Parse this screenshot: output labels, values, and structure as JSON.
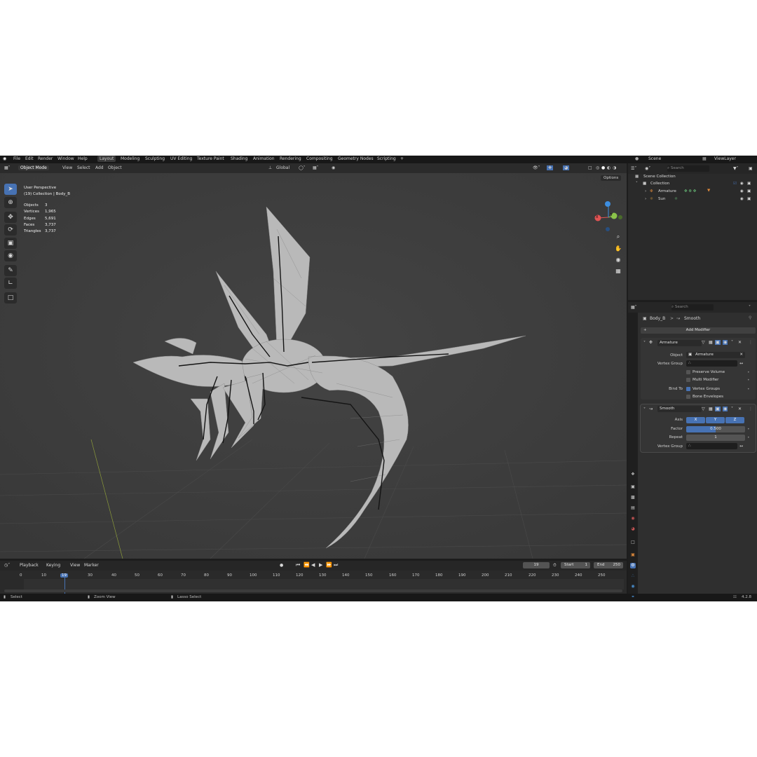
{
  "menu": [
    "File",
    "Edit",
    "Render",
    "Window",
    "Help"
  ],
  "workspaces": [
    "Layout",
    "Modeling",
    "Sculpting",
    "UV Editing",
    "Texture Paint",
    "Shading",
    "Animation",
    "Rendering",
    "Compositing",
    "Geometry Nodes",
    "Scripting"
  ],
  "workspace_add": "+",
  "active_workspace": "Layout",
  "scene": "Scene",
  "view_layer": "ViewLayer",
  "viewport_header": {
    "mode": "Object Mode",
    "menus": [
      "View",
      "Select",
      "Add",
      "Object"
    ],
    "transform": "Global",
    "options": "Options"
  },
  "overlay_text": {
    "perspective": "User Perspective",
    "collection": "(19) Collection | Body_B"
  },
  "stats": [
    {
      "label": "Objects",
      "value": "3"
    },
    {
      "label": "Vertices",
      "value": "1,965"
    },
    {
      "label": "Edges",
      "value": "5,691"
    },
    {
      "label": "Faces",
      "value": "3,737"
    },
    {
      "label": "Triangles",
      "value": "3,737"
    }
  ],
  "gizmo": {
    "x": "X",
    "y": "Y"
  },
  "timeline": {
    "menus": [
      "Playback",
      "Keying",
      "View",
      "Marker"
    ],
    "current_frame": "19",
    "start_label": "Start",
    "start": "1",
    "end_label": "End",
    "end": "250",
    "ticks": [
      "0",
      "10",
      "20",
      "30",
      "40",
      "50",
      "60",
      "70",
      "80",
      "90",
      "100",
      "110",
      "120",
      "130",
      "140",
      "150",
      "160",
      "170",
      "180",
      "190",
      "200",
      "210",
      "220",
      "230",
      "240",
      "250"
    ]
  },
  "status": {
    "select": "Select",
    "zoom": "Zoom View",
    "lasso": "Lasso Select",
    "version": "4.2.8"
  },
  "outliner": {
    "search_placeholder": "Search",
    "scene_collection": "Scene Collection",
    "collection": "Collection",
    "items": [
      "Armature",
      "Sun"
    ]
  },
  "properties": {
    "search_placeholder": "Search",
    "breadcrumb_object": "Body_B",
    "breadcrumb_sep": ">",
    "breadcrumb_modifier": "Smooth",
    "add_modifier": "Add Modifier",
    "armature_mod": {
      "name": "Armature",
      "object_label": "Object",
      "object_value": "Armature",
      "vgroup_label": "Vertex Group",
      "preserve_volume": "Preserve Volume",
      "multi_modifier": "Multi Modifier",
      "bind_to_label": "Bind To",
      "vertex_groups": "Vertex Groups",
      "bone_envelopes": "Bone Envelopes"
    },
    "smooth_mod": {
      "name": "Smooth",
      "axis_label": "Axis",
      "axes": [
        "X",
        "Y",
        "Z"
      ],
      "factor_label": "Factor",
      "factor": "0.500",
      "repeat_label": "Repeat",
      "repeat": "1",
      "vgroup_label": "Vertex Group"
    }
  }
}
